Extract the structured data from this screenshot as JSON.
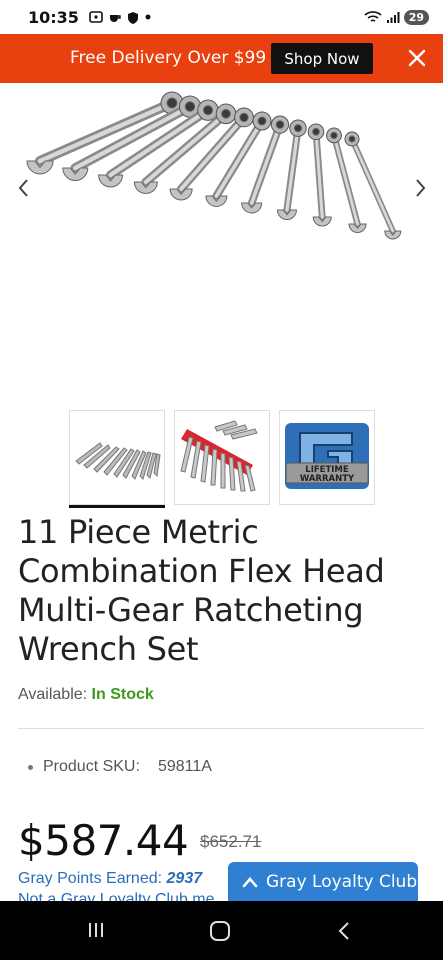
{
  "status_bar": {
    "time": "10:35",
    "battery": "29",
    "left_icons": [
      "screen-icon",
      "cup-icon",
      "shield-icon",
      "dot-icon"
    ],
    "right_icons": [
      "wifi-icon",
      "signal-icon",
      "battery-icon"
    ]
  },
  "promo": {
    "text": "Free Delivery Over $99",
    "button_label": "Shop Now",
    "accent_color": "#e8400f"
  },
  "gallery": {
    "thumbnails": [
      {
        "name": "wrench-set-thumb",
        "active": true
      },
      {
        "name": "wrench-rack-thumb",
        "active": false
      },
      {
        "name": "lifetime-warranty-thumb",
        "active": false,
        "label": "LIFETIME WARRANTY"
      }
    ]
  },
  "product": {
    "title": "11 Piece Metric Combination Flex Head Multi-Gear Ratcheting Wrench Set",
    "available_label": "Available:",
    "availability": "In Stock",
    "sku_label": "Product SKU:",
    "sku": "59811A",
    "price": "$587.44",
    "old_price": "$652.71",
    "points_label": "Gray Points Earned:",
    "points": "2937",
    "points_note": "Not a Gray Loyalty Club me"
  },
  "loyalty": {
    "label": "Gray Loyalty Club",
    "color": "#2f7fd3"
  }
}
